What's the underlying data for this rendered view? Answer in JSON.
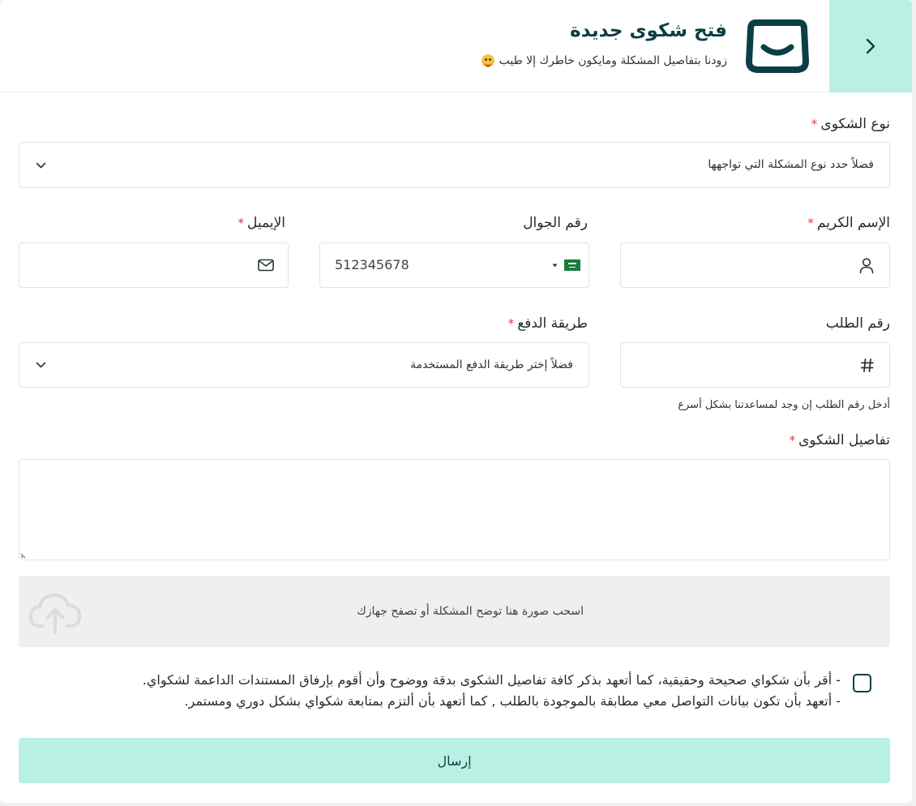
{
  "header": {
    "title": "فتح شكوى جديدة",
    "subtitle": "زودنا بتفاصيل المشكلة ومايكون خاطرك إلا طيب",
    "accent_color": "#b8f1e3",
    "brand_color": "#0b3f45"
  },
  "form": {
    "complaint_type": {
      "label": "نوع الشكوى",
      "required_mark": "*",
      "placeholder": "فضلاً حدد نوع المشكلة التي تواجهها"
    },
    "name": {
      "label": "الإسم الكريم",
      "required_mark": "*",
      "icon": "user-icon"
    },
    "phone": {
      "label": "رقم الجوال",
      "value": "512345678",
      "country_flag": "saudi-flag-icon"
    },
    "email": {
      "label": "الإيميل",
      "required_mark": "*",
      "icon": "mail-icon"
    },
    "order_number": {
      "label": "رقم الطلب",
      "icon": "hash-icon",
      "hint": "أدخل رقم الطلب إن وجد لمساعدتنا بشكل أسرع"
    },
    "payment_method": {
      "label": "طريقة الدفع",
      "required_mark": "*",
      "placeholder": "فضلاً إختر طريقة الدفع المستخدمة"
    },
    "details": {
      "label": "تفاصيل الشكوى",
      "required_mark": "*",
      "value": ""
    },
    "upload": {
      "text": "اسحب صورة هنا توضح المشكلة أو تصفح جهازك",
      "icon": "cloud-upload-icon"
    },
    "agreement": {
      "line1": "- أقر بأن شكواي صحيحة وحقيقية، كما أتعهد بذكر كافة تفاصيل الشكوى بدقة ووضوح وأن أقوم بإرفاق المستندات الداعمة لشكواي.",
      "line2": "- أتعهد بأن تكون بيانات التواصل معي مطابقة بالموجودة بالطلب , كما أتعهد بأن ألتزم بمتابعة شكواي بشكل دوري ومستمر.",
      "checked": false
    },
    "submit_label": "إرسال"
  }
}
